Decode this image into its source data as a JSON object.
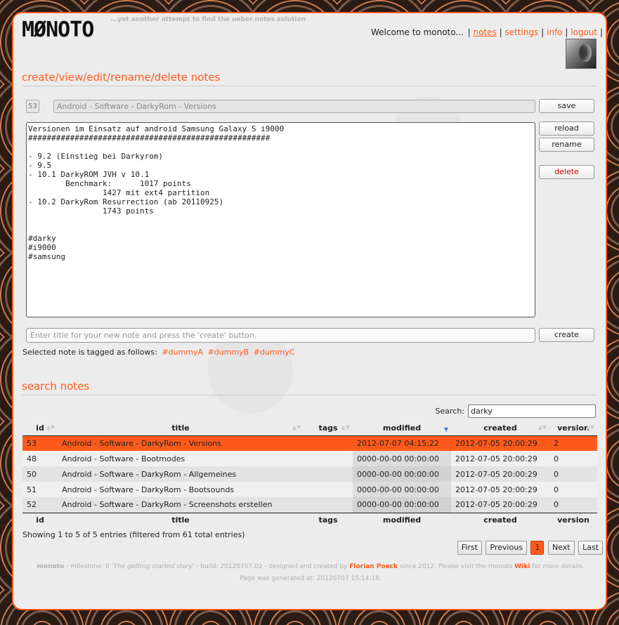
{
  "header": {
    "logo": "MØNOTO",
    "tagline": "...yet another attempt to find the ueber notes solution",
    "welcome": "Welcome to monoto...",
    "nav": [
      {
        "label": "notes",
        "active": true
      },
      {
        "label": "settings"
      },
      {
        "label": "info"
      },
      {
        "label": "logout"
      }
    ]
  },
  "editor_section": {
    "heading": "create/view/edit/rename/delete notes",
    "note_id": "53",
    "note_title": "Android - Software - DarkyRom - Versions",
    "content_lines": [
      "Versionen im Einsatz auf android Samsung Galaxy S i9000",
      "####################################################",
      "",
      "- 9.2 (Einstieg bei Darkyrom)",
      "- 9.5",
      "- 10.1 DarkyROM JVH v 10.1",
      "        Benchmark:      1017 points",
      "                1427 mit ext4 partition",
      "- 10.2 DarkyRom Resurrection (ab 20110925)",
      "                1743 points",
      "",
      "",
      "#darky",
      "#i9000",
      "#samsung"
    ],
    "buttons": {
      "save": "save",
      "reload": "reload",
      "rename": "rename",
      "delete": "delete",
      "create": "create"
    },
    "new_title_placeholder": "Enter title for your new note and press the 'create' button.",
    "tags_label": "Selected note is tagged as follows:",
    "tags": [
      "#dummyA",
      "#dummyB",
      "#dummyC"
    ]
  },
  "search_section": {
    "heading": "search notes",
    "search_label": "Search:",
    "search_value": "darky",
    "columns": [
      "id",
      "title",
      "tags",
      "modified",
      "created",
      "version"
    ],
    "sorted_column": "modified",
    "rows": [
      {
        "id": "53",
        "title": "Android - Software - DarkyRom - Versions",
        "tags": "",
        "modified": "2012-07-07 04:15:22",
        "created": "2012-07-05 20:00:29",
        "version": "2",
        "selected": true
      },
      {
        "id": "48",
        "title": "Android - Software - Bootmodes",
        "tags": "",
        "modified": "0000-00-00 00:00:00",
        "created": "2012-07-05 20:00:29",
        "version": "0"
      },
      {
        "id": "50",
        "title": "Android - Software - DarkyRom - Allgemeines",
        "tags": "",
        "modified": "0000-00-00 00:00:00",
        "created": "2012-07-05 20:00:29",
        "version": "0"
      },
      {
        "id": "51",
        "title": "Android - Software - DarkyRom - Bootsounds",
        "tags": "",
        "modified": "0000-00-00 00:00:00",
        "created": "2012-07-05 20:00:29",
        "version": "0"
      },
      {
        "id": "52",
        "title": "Android - Software - DarkyRom - Screenshots erstellen",
        "tags": "",
        "modified": "0000-00-00 00:00:00",
        "created": "2012-07-05 20:00:29",
        "version": "0"
      }
    ],
    "info": "Showing 1 to 5 of 5 entries (filtered from 61 total entries)",
    "pager": {
      "first": "First",
      "previous": "Previous",
      "current": "1",
      "next": "Next",
      "last": "Last"
    }
  },
  "footer": {
    "brand": "monoto",
    "text1": " - milestone: 0 '",
    "milestone_name": "The getting started story",
    "text2": "' - build: 20120707.02 - designed and created by ",
    "author": "Florian Poeck",
    "text3": " since 2012. Please visit the monoto ",
    "wiki": "Wiki",
    "text4": " for more details.",
    "generated": "Page was generated at: 20120707 15:14:18."
  },
  "colors": {
    "accent": "#ff5a1c",
    "danger": "#d40000",
    "sort_arrow": "#5577dd"
  }
}
